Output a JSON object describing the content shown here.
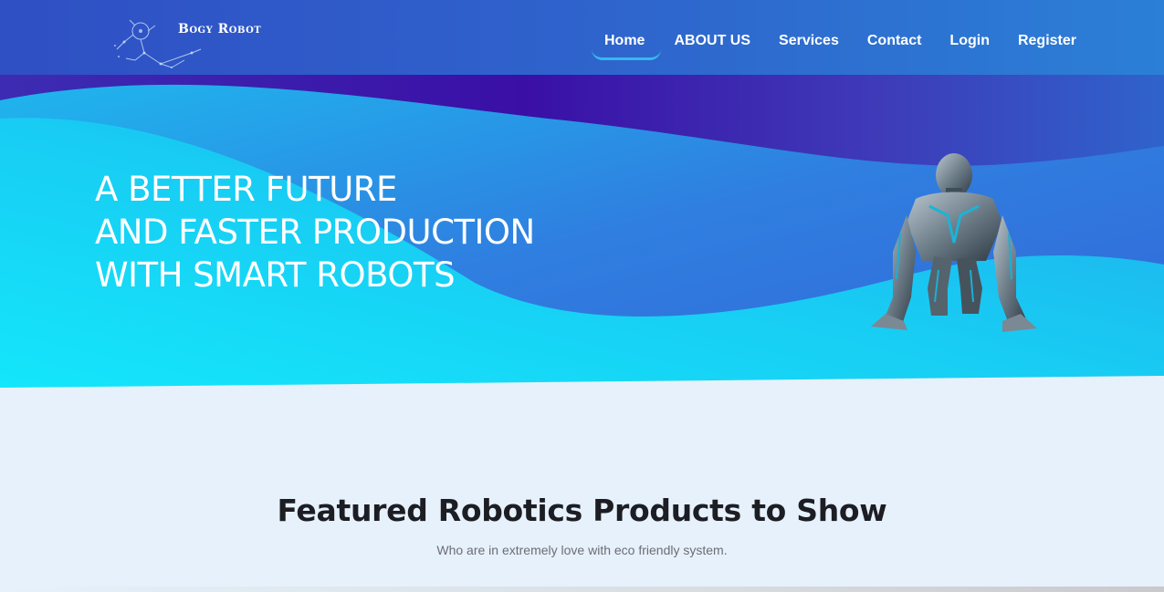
{
  "brand": {
    "name": "Bogy Robot"
  },
  "nav": {
    "items": [
      {
        "label": "Home",
        "active": true
      },
      {
        "label": "ABOUT US",
        "active": false
      },
      {
        "label": "Services",
        "active": false
      },
      {
        "label": "Contact",
        "active": false
      },
      {
        "label": "Login",
        "active": false
      },
      {
        "label": "Register",
        "active": false
      }
    ]
  },
  "hero": {
    "lines": [
      "A BETTER FUTURE",
      "AND FASTER PRODUCTION",
      "WITH SMART ROBOTS"
    ]
  },
  "featured": {
    "title": "Featured Robotics Products to Show",
    "subtitle": "Who are in extremely love with eco friendly system."
  },
  "colors": {
    "nav_bg": "#2f5ec8",
    "hero_cyan": "#17d6f7",
    "hero_purple": "#3a0fa6",
    "active_underline": "#35b9ef",
    "page_bg": "#e6f1fb"
  }
}
